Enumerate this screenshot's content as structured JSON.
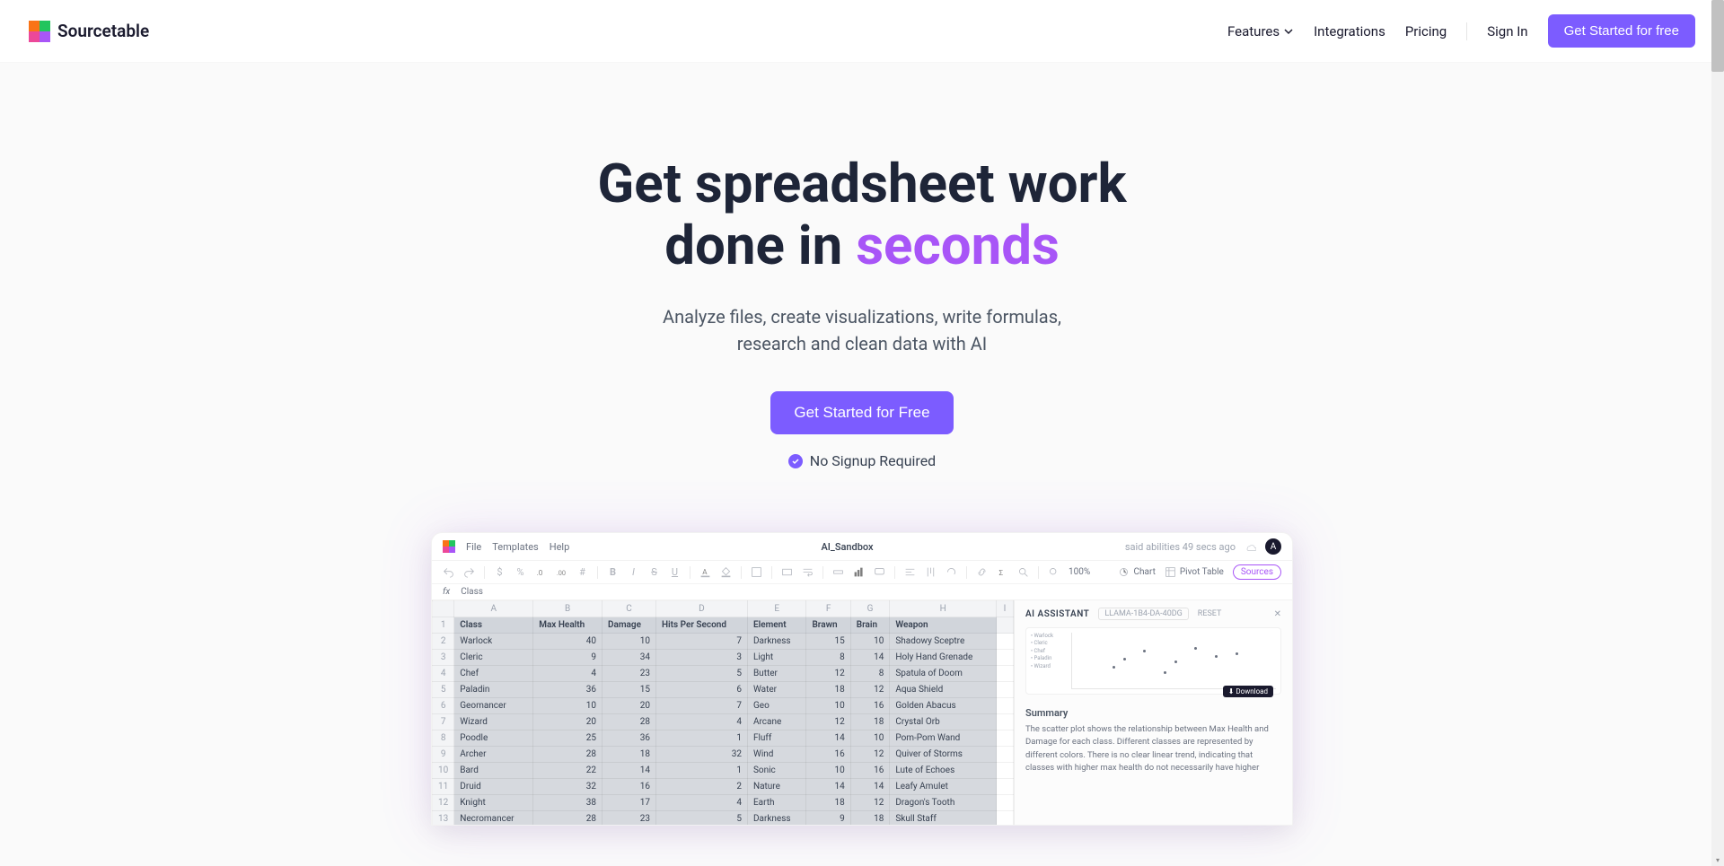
{
  "brand": "Sourcetable",
  "nav": {
    "features": "Features",
    "integrations": "Integrations",
    "pricing": "Pricing",
    "signin": "Sign In",
    "cta": "Get Started for free"
  },
  "hero": {
    "title_line1": "Get spreadsheet work",
    "title_line2a": "done in ",
    "title_line2b": "seconds",
    "subtitle_line1": "Analyze files, create visualizations, write formulas,",
    "subtitle_line2": "research and clean data with AI",
    "cta": "Get Started for Free",
    "note": "No Signup Required"
  },
  "app": {
    "menu": {
      "file": "File",
      "templates": "Templates",
      "help": "Help"
    },
    "title": "AI_Sandbox",
    "saved": "said abilities 49 secs ago",
    "avatar": "A",
    "zoom": "100%",
    "toolbar": {
      "chart": "Chart",
      "pivot": "Pivot Table",
      "sources": "Sources"
    },
    "formula": {
      "cell_ref": "fx",
      "value": "Class"
    },
    "cols": [
      "A",
      "B",
      "C",
      "D",
      "E",
      "F",
      "G",
      "H",
      "I"
    ],
    "headers": [
      "Class",
      "Max Health",
      "Damage",
      "Hits Per Second",
      "Element",
      "Brawn",
      "Brain",
      "Weapon"
    ],
    "rows": [
      [
        "Warlock",
        "40",
        "10",
        "7",
        "Darkness",
        "15",
        "10",
        "Shadowy Sceptre"
      ],
      [
        "Cleric",
        "9",
        "34",
        "3",
        "Light",
        "8",
        "14",
        "Holy Hand Grenade"
      ],
      [
        "Chef",
        "4",
        "23",
        "5",
        "Butter",
        "12",
        "8",
        "Spatula of Doom"
      ],
      [
        "Paladin",
        "36",
        "15",
        "6",
        "Water",
        "18",
        "12",
        "Aqua Shield"
      ],
      [
        "Geomancer",
        "10",
        "20",
        "7",
        "Geo",
        "10",
        "16",
        "Golden Abacus"
      ],
      [
        "Wizard",
        "20",
        "28",
        "4",
        "Arcane",
        "12",
        "18",
        "Crystal Orb"
      ],
      [
        "Poodle",
        "25",
        "36",
        "1",
        "Fluff",
        "14",
        "10",
        "Pom-Pom Wand"
      ],
      [
        "Archer",
        "28",
        "18",
        "32",
        "Wind",
        "16",
        "12",
        "Quiver of Storms"
      ],
      [
        "Bard",
        "22",
        "14",
        "1",
        "Sonic",
        "10",
        "16",
        "Lute of Echoes"
      ],
      [
        "Druid",
        "32",
        "16",
        "2",
        "Nature",
        "14",
        "14",
        "Leafy Amulet"
      ],
      [
        "Knight",
        "38",
        "17",
        "4",
        "Earth",
        "18",
        "12",
        "Dragon's Tooth"
      ],
      [
        "Necromancer",
        "28",
        "23",
        "5",
        "Darkness",
        "9",
        "18",
        "Skull Staff"
      ]
    ],
    "ai": {
      "title": "AI ASSISTANT",
      "model": "LLAMA-1B4-DA-40DG",
      "reset": "RESET",
      "download": "Download",
      "summary_title": "Summary",
      "summary_text": "The scatter plot shows the relationship between Max Health and Damage for each class. Different classes are represented by different colors. There is no clear linear trend, indicating that classes with higher max health do not necessarily have higher"
    }
  }
}
